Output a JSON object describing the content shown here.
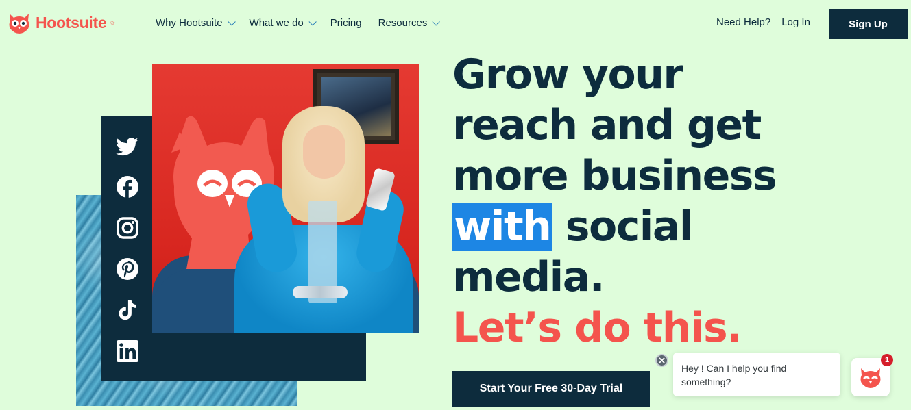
{
  "header": {
    "logo_text": "Hootsuite",
    "logo_reg": "®",
    "nav": [
      {
        "label": "Why Hootsuite",
        "dropdown": true
      },
      {
        "label": "What we do",
        "dropdown": true
      },
      {
        "label": "Pricing",
        "dropdown": false
      },
      {
        "label": "Resources",
        "dropdown": true
      }
    ],
    "help_label": "Need Help?",
    "login_label": "Log In",
    "signup_label": "Sign Up"
  },
  "hero": {
    "headline_lines": [
      "Grow your",
      "reach and get",
      "more business"
    ],
    "highlight_word": "with",
    "line4_rest": " social",
    "line5": "media.",
    "cta_line": "Let’s do this.",
    "trial_button": "Start Your Free 30-Day Trial",
    "social_icons": [
      "twitter-icon",
      "facebook-icon",
      "instagram-icon",
      "pinterest-icon",
      "tiktok-icon",
      "linkedin-icon"
    ]
  },
  "chat": {
    "message": "Hey ! Can I help you find something?",
    "badge_count": "1"
  },
  "colors": {
    "background": "#dffddb",
    "navy": "#0d2c3d",
    "brand_red": "#f4544d",
    "highlight_blue": "#1d86e4"
  }
}
